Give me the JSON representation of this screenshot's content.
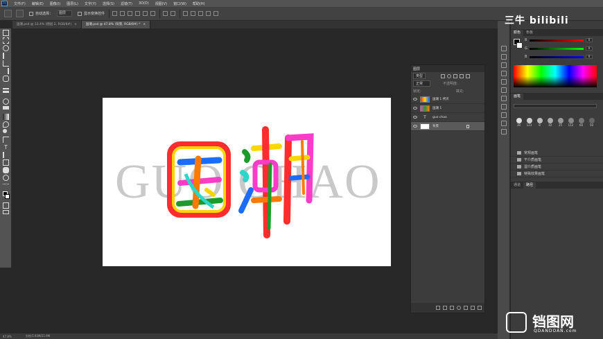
{
  "menubar": {
    "logo": "Ps",
    "items": [
      "文件(F)",
      "编辑(E)",
      "图像(I)",
      "图层(L)",
      "文字(Y)",
      "选择(S)",
      "滤镜(T)",
      "3D(D)",
      "视图(V)",
      "窗口(W)",
      "帮助(H)"
    ]
  },
  "options": {
    "auto_select": "自动选择：",
    "auto_select_value": "图层",
    "show_transform": "显示变换控件"
  },
  "tabs": [
    {
      "label": "国潮.psd @ 33.4% (图层 2, RGB/8#)",
      "close": "×"
    },
    {
      "label": "国潮.psd @ 47.8% (背景, RGB/8#) *",
      "close": "×"
    }
  ],
  "canvas": {
    "background_text": "GUO CHAO",
    "main_text": "国潮",
    "colors": [
      "#ff2d2d",
      "#ffd500",
      "#1b9b2c",
      "#1c6cff",
      "#ff3cc8",
      "#ff7a00",
      "#2ad7c8"
    ]
  },
  "layers": {
    "title": "图层",
    "filter_label": "类型",
    "mode_label": "正常",
    "opacity_label": "不透明度:",
    "lock_label": "锁定:",
    "fill_label": "填充:",
    "rows": [
      {
        "name": "国潮 1 拷贝",
        "selected": false
      },
      {
        "name": "国潮 1",
        "selected": false
      },
      {
        "name": "guo chao",
        "selected": false
      },
      {
        "name": "背景",
        "selected": true
      }
    ]
  },
  "right_panel": {
    "color_tabs": [
      "颜色",
      "色板"
    ],
    "rgb": [
      {
        "label": "R",
        "value": "0"
      },
      {
        "label": "G",
        "value": "0"
      },
      {
        "label": "B",
        "value": "0"
      }
    ],
    "brush_tab": "画笔",
    "brush_sizes": [
      "30",
      "123",
      "8",
      "10",
      "25",
      "112",
      "60",
      "50",
      "25",
      "30",
      "50",
      "60",
      "100",
      "127",
      "284",
      "80"
    ],
    "folders": [
      "常规画笔",
      "干介质画笔",
      "湿介质画笔",
      "特殊效果画笔"
    ],
    "bottom_tabs": [
      "通道",
      "路径"
    ]
  },
  "watermark": {
    "top": "三牛 bilibili",
    "brand": "铛图网",
    "url": "QDANDOAN.com"
  },
  "status": {
    "zoom": "47.8%",
    "doc": "文档:5.93M/21.9M"
  }
}
